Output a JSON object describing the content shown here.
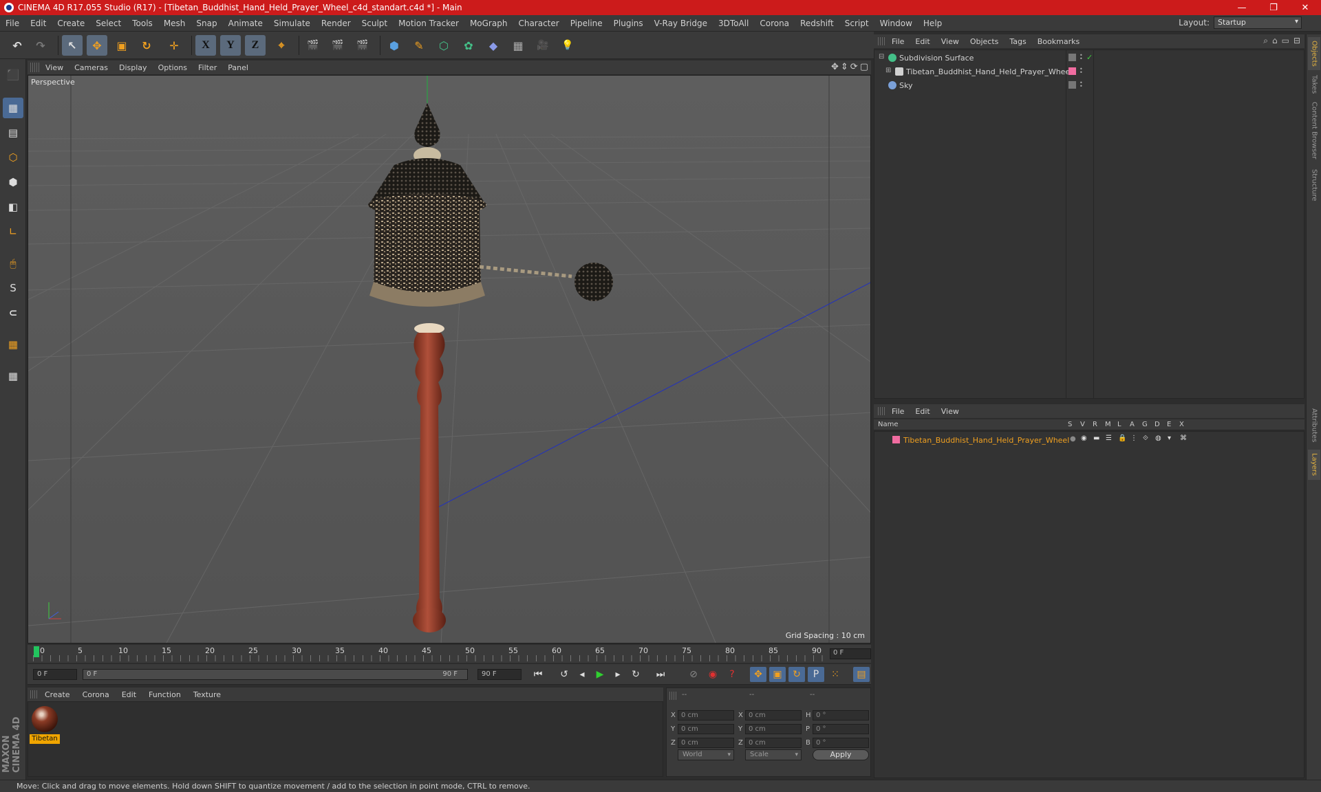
{
  "window": {
    "title": "CINEMA 4D R17.055 Studio (R17) - [Tibetan_Buddhist_Hand_Held_Prayer_Wheel_c4d_standart.c4d *] - Main",
    "minimize": "—",
    "maximize": "❐",
    "close": "✕"
  },
  "menu": [
    "File",
    "Edit",
    "Create",
    "Select",
    "Tools",
    "Mesh",
    "Snap",
    "Animate",
    "Simulate",
    "Render",
    "Sculpt",
    "Motion Tracker",
    "MoGraph",
    "Character",
    "Pipeline",
    "Plugins",
    "V-Ray Bridge",
    "3DToAll",
    "Corona",
    "Redshift",
    "Script",
    "Window",
    "Help"
  ],
  "layout": {
    "label": "Layout:",
    "value": "Startup"
  },
  "toolbar": {
    "undo": "↶",
    "redo": "↷",
    "select": "↖",
    "move": "✥",
    "scale": "▣",
    "rotate": "↻",
    "transform": "✛",
    "x": "X",
    "y": "Y",
    "z": "Z",
    "coord": "⌖",
    "render_view": "🎬",
    "render_pic": "🎬",
    "render_settings": "🎬",
    "cube": "⬢",
    "pen": "✎",
    "subdiv": "⬡",
    "array": "✿",
    "deform": "◆",
    "floor": "▦",
    "camera": "🎥",
    "light": "💡"
  },
  "lefttools": [
    "⬛",
    "▦",
    "▤",
    "⬡",
    "⬢",
    "◧",
    "∟",
    "🖱",
    "S",
    "⊂",
    "▦",
    "▦"
  ],
  "maxon": "MAXON CINEMA 4D",
  "viewport": {
    "menu": [
      "View",
      "Cameras",
      "Display",
      "Options",
      "Filter",
      "Panel"
    ],
    "label": "Perspective",
    "grid_spacing": "Grid Spacing : 10 cm",
    "nav_icons": [
      "✥",
      "⇕",
      "⟳",
      "▢"
    ]
  },
  "timeline": {
    "ticks": [
      "0",
      "5",
      "10",
      "15",
      "20",
      "25",
      "30",
      "35",
      "40",
      "45",
      "50",
      "55",
      "60",
      "65",
      "70",
      "75",
      "80",
      "85",
      "90"
    ],
    "current_frame": "0 F"
  },
  "playback": {
    "start": "0 F",
    "range_start": "0 F",
    "range_end": "90 F",
    "end": "90 F",
    "buttons": [
      "⏮",
      "↺",
      "◂",
      "▶",
      "▸",
      "↻",
      "⏭"
    ],
    "key_buttons": [
      "⊘",
      "◉",
      "?",
      "✥",
      "▣",
      "↻",
      "P",
      "⁙",
      "▤"
    ]
  },
  "material_manager": {
    "menu": [
      "Create",
      "Corona",
      "Edit",
      "Function",
      "Texture"
    ],
    "material_name": "Tibetan"
  },
  "coordinates": {
    "headers": [
      "--",
      "--",
      "--"
    ],
    "rows": [
      {
        "a": "X",
        "a_val": "0 cm",
        "b": "X",
        "b_val": "0 cm",
        "c": "H",
        "c_val": "0 °"
      },
      {
        "a": "Y",
        "a_val": "0 cm",
        "b": "Y",
        "b_val": "0 cm",
        "c": "P",
        "c_val": "0 °"
      },
      {
        "a": "Z",
        "a_val": "0 cm",
        "b": "Z",
        "b_val": "0 cm",
        "c": "B",
        "c_val": "0 °"
      }
    ],
    "world": "World",
    "scale": "Scale",
    "apply": "Apply"
  },
  "object_manager": {
    "menu": [
      "File",
      "Edit",
      "View",
      "Objects",
      "Tags",
      "Bookmarks"
    ],
    "icons": [
      "⌕",
      "⌂",
      "▭",
      "⊟"
    ],
    "objects": [
      {
        "name": "Subdivision Surface",
        "icon_color": "#44c088"
      },
      {
        "name": "Tibetan_Buddhist_Hand_Held_Prayer_Wheel",
        "icon_color": "#d0d0d0",
        "tag_color": "#f06ca0"
      },
      {
        "name": "Sky",
        "icon_color": "#7aa0d8"
      }
    ],
    "check": "✓"
  },
  "layer_manager": {
    "menu": [
      "File",
      "Edit",
      "View"
    ],
    "columns": [
      "Name",
      "S",
      "V",
      "R",
      "M",
      "L",
      "A",
      "G",
      "D",
      "E",
      "X"
    ],
    "layer_name": "Tibetan_Buddhist_Hand_Held_Prayer_Wheel",
    "layer_color": "#f06ca0"
  },
  "right_tabs": [
    "Objects",
    "Takes",
    "Content Browser",
    "Structure",
    "Attributes",
    "Layers"
  ],
  "status": "Move: Click and drag to move elements. Hold down SHIFT to quantize movement / add to the selection in point mode, CTRL to remove."
}
